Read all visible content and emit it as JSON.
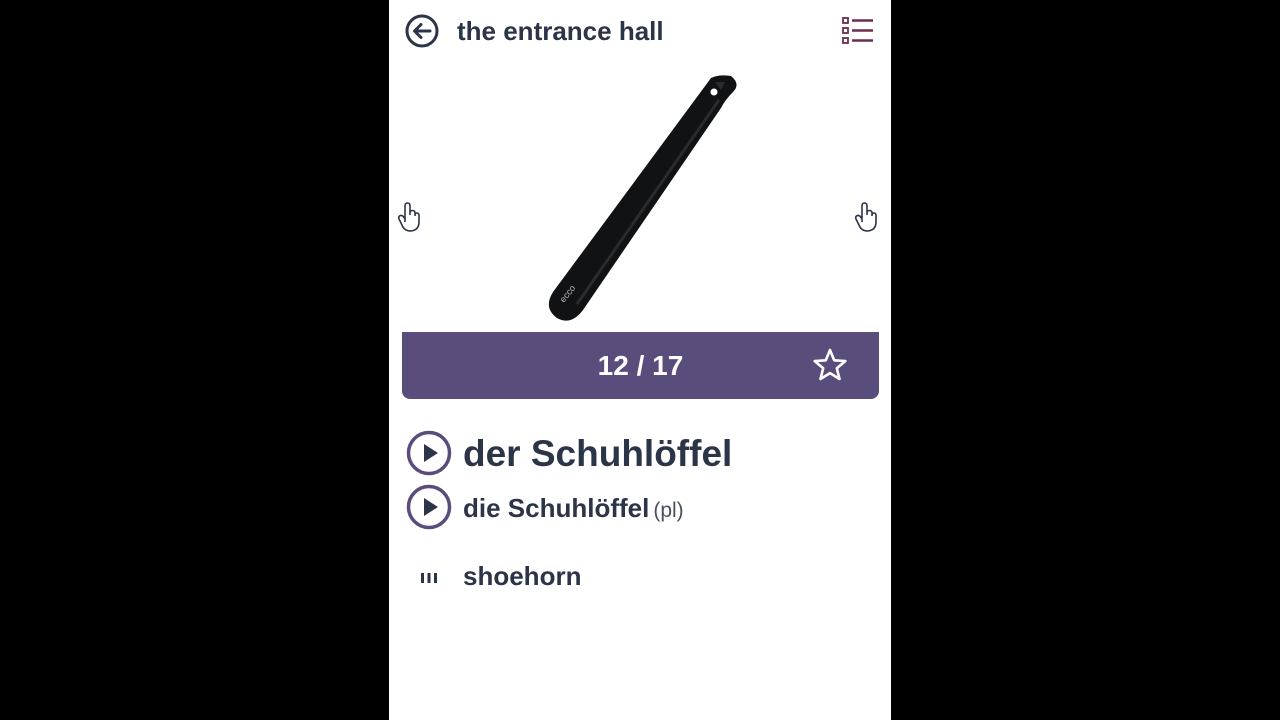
{
  "header": {
    "title": "the entrance hall",
    "back_icon": "arrow-left-circle-icon",
    "menu_icon": "list-icon"
  },
  "image": {
    "subject": "shoehorn",
    "brand_mark": "ecco"
  },
  "navigation": {
    "prev_icon": "pointing-hand-icon",
    "next_icon": "pointing-hand-icon"
  },
  "counter": {
    "text": "12 / 17",
    "current": 12,
    "total": 17,
    "star_icon": "star-outline-icon"
  },
  "word": {
    "singular": "der Schuhlöffel",
    "plural": "die Schuhlöffel",
    "plural_tag": "(pl)",
    "translation": "shoehorn",
    "play_icon": "play-circle-icon",
    "translation_icon": "bars-icon"
  },
  "colors": {
    "accent": "#5a4d7c",
    "text": "#2c3448",
    "menu": "#6b2d4e",
    "background": "#ffffff",
    "frame": "#000000"
  }
}
